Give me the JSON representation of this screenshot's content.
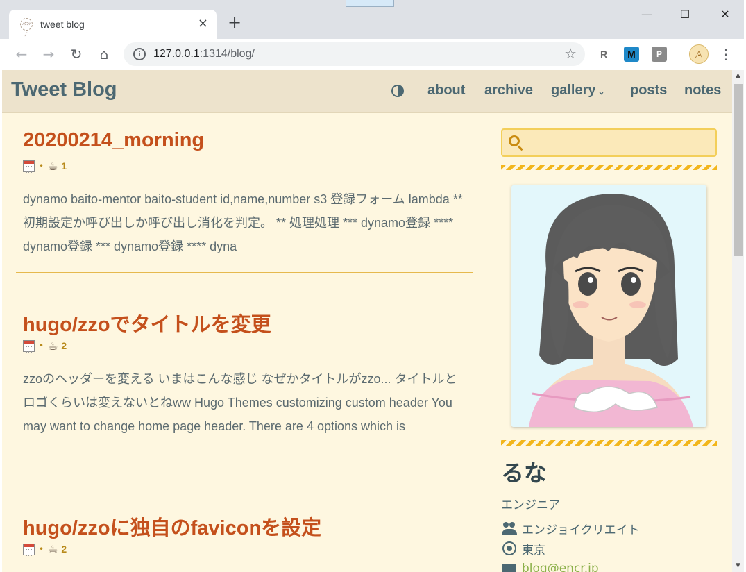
{
  "browser": {
    "tab_title": "tweet blog",
    "tab_close": "×",
    "new_tab": "+",
    "url_host": "127.0.0.1",
    "url_rest": ":1314/blog/",
    "favicon_text": "ｽｸﾗｯﾌﾟ",
    "window_controls": {
      "minimize": "—",
      "maximize": "☐",
      "close": "✕"
    },
    "extensions": [
      {
        "letter": "R",
        "name": "r-extension-icon"
      },
      {
        "letter": "M",
        "name": "m-extension-icon"
      },
      {
        "letter": "P",
        "name": "p-extension-icon"
      }
    ]
  },
  "site": {
    "title": "Tweet Blog",
    "nav": {
      "about": "about",
      "archive": "archive",
      "gallery": "gallery",
      "posts": "posts",
      "notes": "notes"
    }
  },
  "posts": [
    {
      "title": "20200214_morning",
      "read_time": "1",
      "excerpt": "dynamo baito-mentor baito-student id,name,number s3 登録フォーム lambda ** 初期設定か呼び出しか呼び出し消化を判定。 ** 処理処理 *** dynamo登録 **** dynamo登録 *** dynamo登録 **** dyna"
    },
    {
      "title": "hugo/zzoでタイトルを変更",
      "read_time": "2",
      "excerpt": "zzoのヘッダーを変える いまはこんな感じ なぜかタイトルがzzo... タイトルとロゴくらいは変えないとねww Hugo Themes customizing custom header You may want to change home page header. There are 4 options which is"
    },
    {
      "title": "hugo/zzoに独自のfaviconを設定",
      "read_time": "2"
    }
  ],
  "sidebar": {
    "search_value": "",
    "author_name": "るな",
    "author_role": "エンジニア",
    "organization": "エンジョイクリエイト",
    "location": "東京",
    "email": "blog@encr.jp"
  }
}
